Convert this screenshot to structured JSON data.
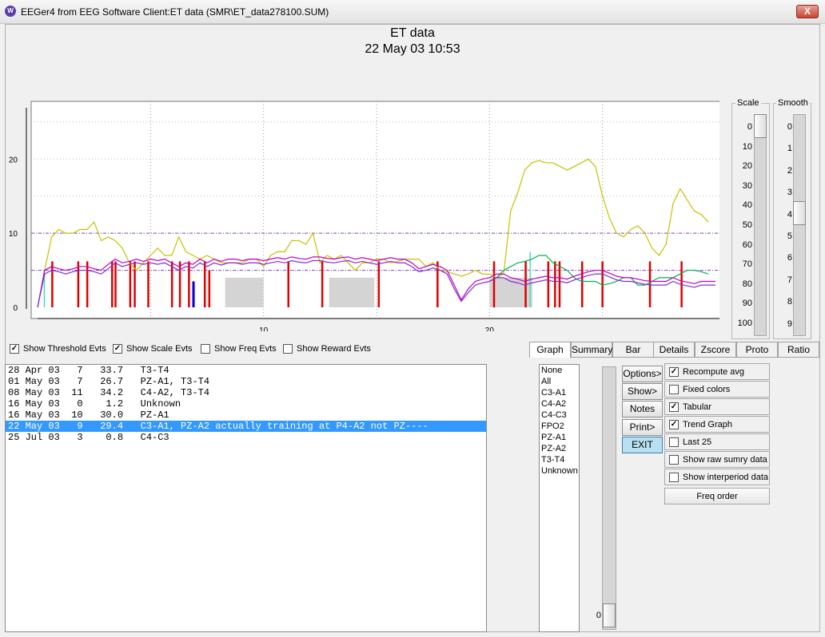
{
  "window": {
    "title": "EEGer4 from EEG Software  Client:ET data  (SMR\\ET_data278100.SUM)",
    "close_label": "X",
    "icon_label": "W"
  },
  "header": {
    "title": "ET data",
    "subtitle": "22 May 03   10:53"
  },
  "chart_data": {
    "type": "line",
    "xlim": [
      0,
      30
    ],
    "ylim": [
      0,
      28
    ],
    "x_ticks": [
      "10",
      "20"
    ],
    "y_ticks": [
      "0",
      "10",
      "20"
    ],
    "grid": true,
    "series": [
      {
        "color": "#c8c000",
        "values": [
          0,
          5,
          9.5,
          10.5,
          10,
          10,
          10.5,
          10.5,
          11.5,
          9,
          9.5,
          9,
          8,
          6,
          5,
          6,
          7,
          8,
          7,
          7,
          9.5,
          7.5,
          7,
          6.5,
          7,
          6.5,
          6,
          6,
          6,
          6,
          6.5,
          6.5,
          5.5,
          7,
          7.5,
          7.5,
          9,
          9,
          8.5,
          10,
          6,
          7,
          6.5,
          7,
          6,
          5,
          6,
          6,
          6.5,
          6.5,
          6,
          6.2,
          6.5,
          6.5,
          6.5,
          5.5,
          6,
          5,
          4.8,
          4.5,
          4.2,
          4.5,
          5,
          4.5,
          4.5,
          4,
          4.5,
          13,
          15.5,
          18.5,
          19.5,
          19.8,
          19.5,
          19.5,
          19,
          18.5,
          19,
          19.5,
          20,
          19,
          15,
          12,
          10,
          9.5,
          10.5,
          11,
          10,
          8,
          7,
          8.5,
          14,
          16,
          14.5,
          13,
          12.5,
          11.5
        ]
      },
      {
        "color": "#00b050",
        "start": 64,
        "values": [
          3.5,
          4,
          5,
          5.5,
          6,
          6.2,
          6.5,
          7,
          7,
          6,
          5.5,
          5,
          4,
          3.5,
          3.5,
          3.5,
          3,
          3.2,
          3.5,
          4,
          4,
          3,
          3,
          3.5,
          4,
          4,
          4,
          4.5,
          5,
          5,
          4.8,
          4.5
        ]
      },
      {
        "color": "#c000c0",
        "values": [
          0,
          5,
          5.5,
          5.2,
          5,
          5.2,
          5.5,
          5.5,
          5.2,
          5,
          5.8,
          6.5,
          6,
          6.2,
          6.5,
          6.2,
          6.5,
          6.3,
          6.5,
          6,
          5.5,
          6,
          5.8,
          6.5,
          6,
          6.5,
          6.2,
          6.5,
          6.5,
          6.3,
          6.5,
          6.5,
          6.3,
          6.5,
          6.7,
          6.5,
          6.8,
          6.6,
          6.5,
          6.8,
          6.8,
          6.6,
          6.5,
          6.7,
          6.8,
          6.5,
          6.7,
          6.5,
          6.3,
          6.5,
          6.7,
          6.5,
          6.5,
          6,
          5.2,
          5.5,
          5.8,
          5.5,
          5,
          3,
          1,
          2.5,
          3.5,
          3.8,
          4,
          4.5,
          4.5,
          4,
          3.8,
          3.5,
          3.8,
          4,
          4.2,
          4,
          4,
          3.8,
          4.2,
          4.5,
          4.8,
          5,
          5,
          4.6,
          4.2,
          4,
          4,
          3.8,
          3.6,
          3.5,
          3.5,
          3.5,
          4,
          3.6,
          3.4,
          3.2,
          3.5,
          3.5,
          3.5
        ]
      },
      {
        "color": "#8030d0",
        "values": [
          0,
          4.5,
          5,
          4.8,
          4.5,
          4.8,
          5,
          5,
          4.8,
          4.5,
          5.2,
          6,
          5.5,
          5.8,
          6,
          5.8,
          6,
          5.8,
          6,
          5.5,
          5,
          5.5,
          5.3,
          6,
          5.5,
          6,
          5.7,
          6,
          6,
          5.8,
          6,
          6,
          5.8,
          6,
          6.2,
          6,
          6.3,
          6.1,
          6,
          6.3,
          6.3,
          6.1,
          6,
          6.2,
          6.3,
          6,
          6.2,
          6,
          5.8,
          6,
          6.2,
          6,
          6,
          5.5,
          4.8,
          5,
          5.3,
          5,
          4.5,
          2.5,
          0.8,
          2,
          3,
          3.3,
          3.5,
          4,
          4,
          3.5,
          3.3,
          3,
          3.3,
          3.5,
          3.7,
          3.5,
          3.5,
          3.3,
          3.7,
          4,
          4.3,
          4.5,
          4.5,
          4.1,
          3.7,
          3.5,
          3.5,
          3.3,
          3.1,
          3,
          3,
          3,
          3.5,
          3.1,
          2.9,
          2.7,
          3,
          3,
          3
        ]
      }
    ],
    "threshold_lines": [
      {
        "color": "#8040d0",
        "y": 10
      },
      {
        "color": "#8040d0",
        "y": 5
      }
    ],
    "gray_boxes": [
      {
        "x0": 8.3,
        "x1": 10,
        "y": 4
      },
      {
        "x0": 12.9,
        "x1": 14.9,
        "y": 4
      },
      {
        "x0": 20.0,
        "x1": 21.9,
        "y": 4
      }
    ],
    "red_bars": [
      {
        "x": 0.65,
        "h": 6.2
      },
      {
        "x": 1.8,
        "h": 6.2
      },
      {
        "x": 2.2,
        "h": 6.2
      },
      {
        "x": 3.3,
        "h": 6.2
      },
      {
        "x": 3.45,
        "h": 6.2
      },
      {
        "x": 4.1,
        "h": 6.2
      },
      {
        "x": 4.3,
        "h": 6.2
      },
      {
        "x": 4.9,
        "h": 6.2
      },
      {
        "x": 5.95,
        "h": 6.2
      },
      {
        "x": 6.3,
        "h": 6.2
      },
      {
        "x": 6.7,
        "h": 6.2
      },
      {
        "x": 7.4,
        "h": 6.2
      },
      {
        "x": 7.6,
        "h": 5
      },
      {
        "x": 11.1,
        "h": 6.2
      },
      {
        "x": 12.6,
        "h": 6.2
      },
      {
        "x": 15.1,
        "h": 6.2
      },
      {
        "x": 17.7,
        "h": 6.2
      },
      {
        "x": 20.2,
        "h": 6.2
      },
      {
        "x": 21.6,
        "h": 6.2
      },
      {
        "x": 22.6,
        "h": 6.2
      },
      {
        "x": 22.9,
        "h": 6.2
      },
      {
        "x": 23.1,
        "h": 6.2
      },
      {
        "x": 24.1,
        "h": 6.2
      },
      {
        "x": 25.0,
        "h": 6.2
      },
      {
        "x": 27.1,
        "h": 6.2
      },
      {
        "x": 28.5,
        "h": 6.2
      }
    ],
    "blue_bars": [
      {
        "x": 6.9,
        "h": 3.5
      }
    ],
    "cyan_bars": [
      {
        "x": 0.3,
        "h": 5
      },
      {
        "x": 21.8,
        "h": 7.5
      }
    ]
  },
  "scale_slider": {
    "label": "Scale",
    "ticks": [
      "0",
      "10",
      "20",
      "30",
      "40",
      "50",
      "60",
      "70",
      "80",
      "90",
      "100"
    ]
  },
  "smooth_slider": {
    "label": "Smooth",
    "ticks": [
      "0",
      "1",
      "2",
      "3",
      "4",
      "5",
      "6",
      "7",
      "8",
      "9"
    ]
  },
  "event_checkboxes": [
    {
      "label": "Show Threshold Evts",
      "checked": true
    },
    {
      "label": "Show Scale Evts",
      "checked": true
    },
    {
      "label": "Show Freq Evts",
      "checked": false
    },
    {
      "label": "Show Reward Evts",
      "checked": false
    }
  ],
  "view_tabs": [
    "Graph",
    "Summary",
    "Bar",
    "Details",
    "Zscore",
    "Proto",
    "Ratio"
  ],
  "sessions": [
    "28 Apr 03   7   33.7   T3-T4",
    "01 May 03   7   26.7   PZ-A1, T3-T4",
    "08 May 03  11   34.2   C4-A2, T3-T4",
    "16 May 03   0    1.2   Unknown",
    "16 May 03  10   30.0   PZ-A1",
    "22 May 03   9   29.4   C3-A1, PZ-A2 actually training at P4-A2 not PZ----",
    "25 Jul 03   3    0.8   C4-C3"
  ],
  "selected_session": 5,
  "channels": [
    "None",
    "All",
    "C3-A1",
    "C4-A2",
    "C4-C3",
    "FPO2",
    "PZ-A1",
    "PZ-A2",
    "T3-T4",
    "Unknown"
  ],
  "scroll_value": "0",
  "action_buttons": [
    "Options>",
    "Show>",
    "Notes",
    "Print>",
    "EXIT"
  ],
  "options": [
    {
      "label": "Recompute avg",
      "checked": true
    },
    {
      "label": "Fixed colors",
      "checked": false
    },
    {
      "label": "Tabular",
      "checked": true
    },
    {
      "label": "Trend Graph",
      "checked": true
    },
    {
      "label": "Last 25",
      "checked": false
    },
    {
      "label": "Show raw sumry data",
      "checked": false
    },
    {
      "label": "Show interperiod data",
      "checked": false
    }
  ],
  "freq_order_label": "Freq order"
}
